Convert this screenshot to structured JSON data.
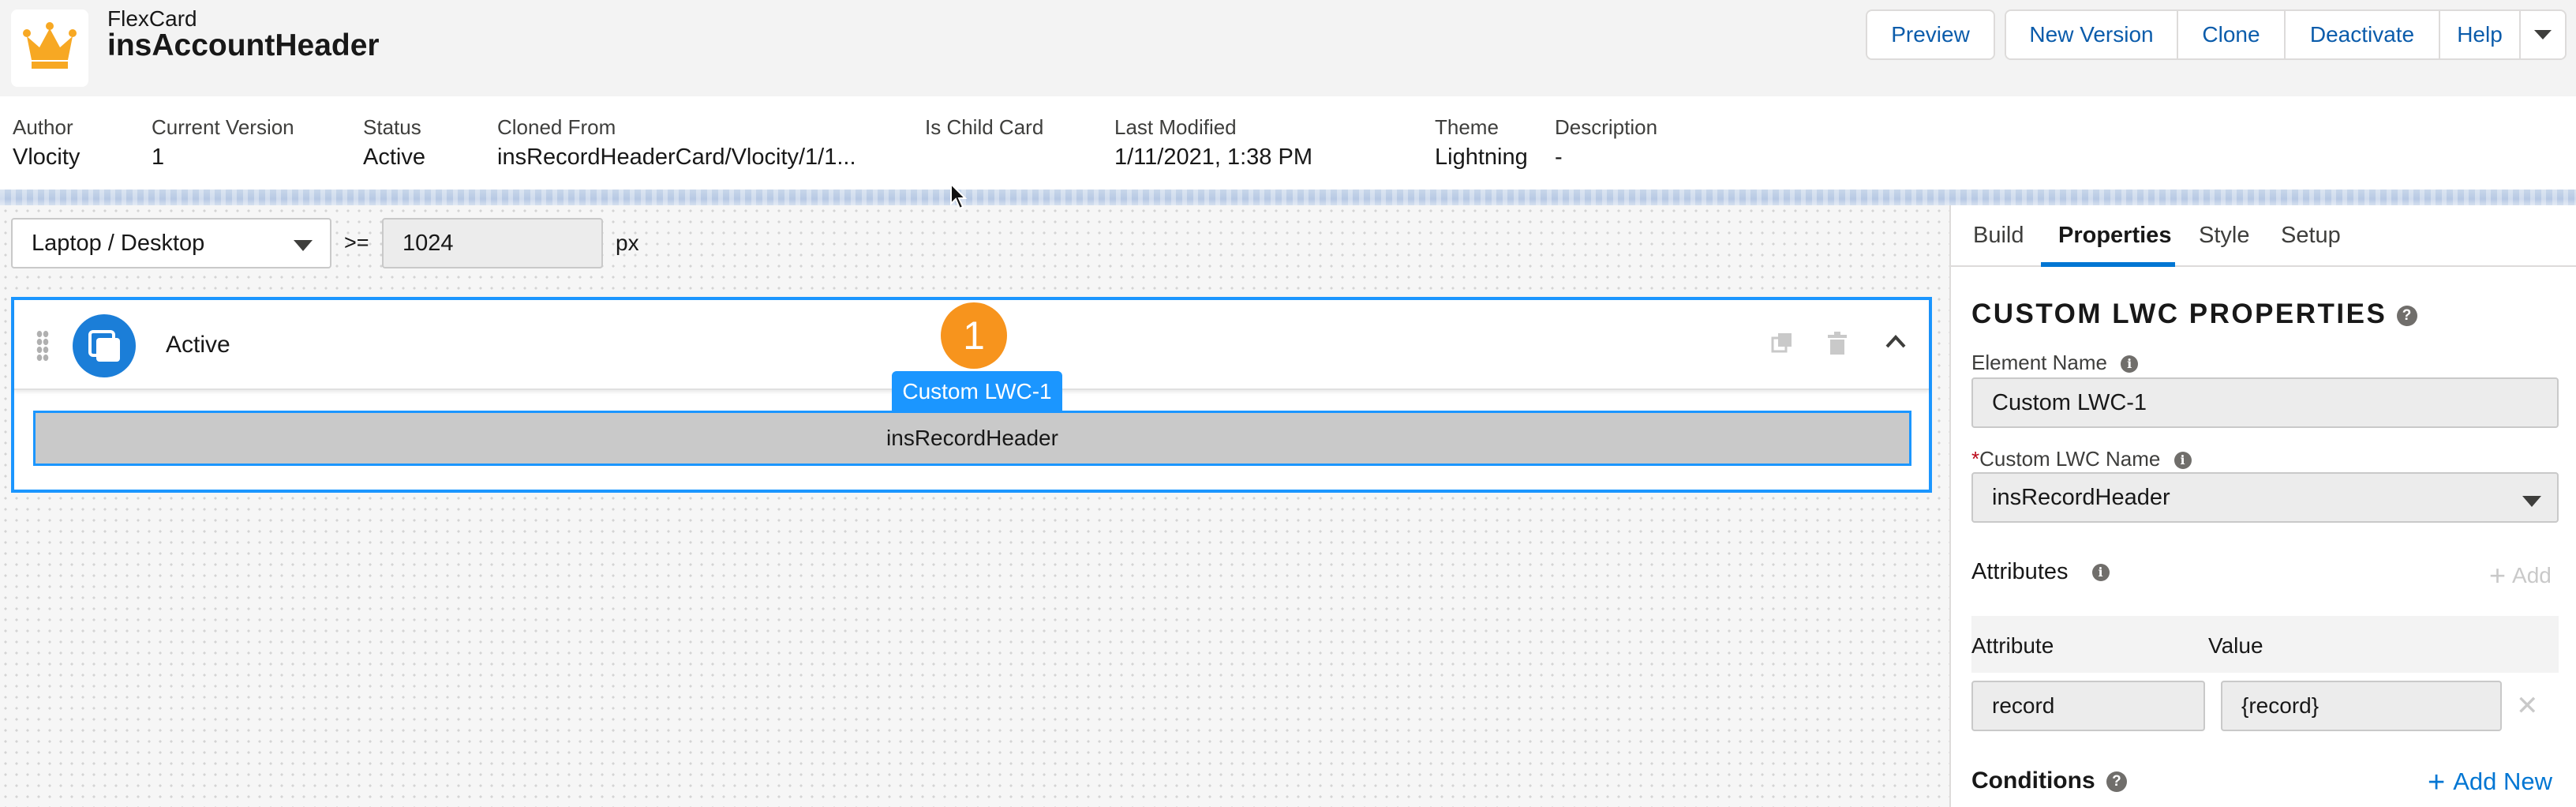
{
  "header": {
    "object_type": "FlexCard",
    "record_name": "insAccountHeader",
    "buttons": [
      "Preview",
      "New Version",
      "Clone",
      "Deactivate",
      "Help"
    ],
    "brand_color": "#f7a823"
  },
  "details": [
    {
      "label": "Author",
      "value": "Vlocity"
    },
    {
      "label": "Current Version",
      "value": "1"
    },
    {
      "label": "Status",
      "value": "Active"
    },
    {
      "label": "Cloned From",
      "value": "insRecordHeaderCard/Vlocity/1/1..."
    },
    {
      "label": "Is Child Card",
      "value": ""
    },
    {
      "label": "Last Modified",
      "value": "1/11/2021, 1:38 PM"
    },
    {
      "label": "Theme",
      "value": "Lightning"
    },
    {
      "label": "Description",
      "value": "-"
    }
  ],
  "canvas": {
    "device": "Laptop / Desktop",
    "operator": ">=",
    "width_value": "1024",
    "width_unit": "px",
    "state": {
      "name": "Active",
      "badge": "1",
      "element_tag": "Custom LWC-1",
      "element_content": "insRecordHeader"
    },
    "accent_color": "#1b96ff"
  },
  "panel": {
    "tabs": [
      "Build",
      "Properties",
      "Style",
      "Setup"
    ],
    "active_tab": "Properties",
    "title": "CUSTOM LWC PROPERTIES",
    "element_name_label": "Element Name",
    "element_name_value": "Custom LWC-1",
    "required_marker": "*",
    "lwc_name_label": "Custom LWC Name",
    "lwc_name_value": "insRecordHeader",
    "attributes_label": "Attributes",
    "add_label": "Add",
    "attribute_header": "Attribute",
    "value_header": "Value",
    "attributes": [
      {
        "attribute": "record",
        "value": "{record}"
      }
    ],
    "conditions_label": "Conditions",
    "add_new_label": "Add New"
  }
}
